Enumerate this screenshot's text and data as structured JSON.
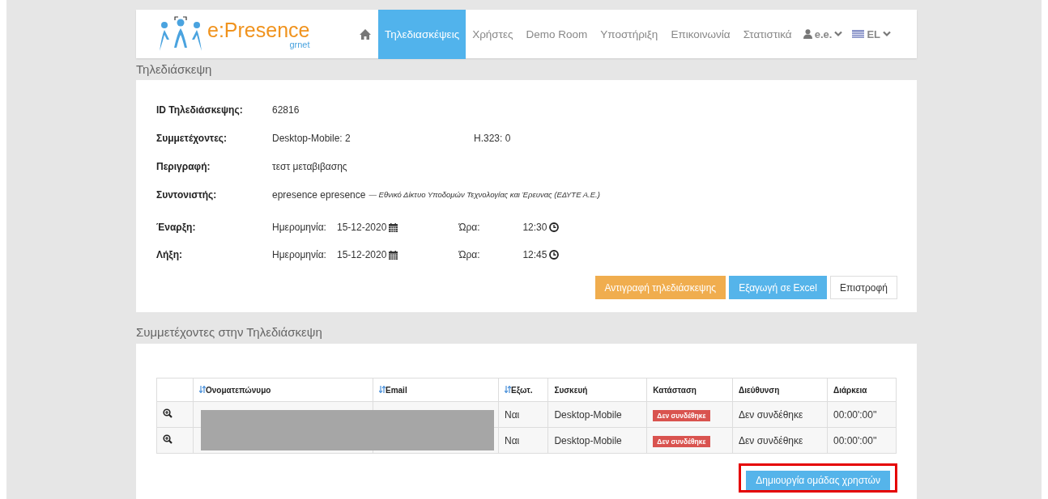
{
  "nav": {
    "logo": {
      "brand": "e:Presence",
      "sub": "grnet"
    },
    "items": [
      {
        "label": "Τηλεδιασκέψεις",
        "selected": true
      },
      {
        "label": "Χρήστες",
        "selected": false
      },
      {
        "label": "Demo Room",
        "selected": false
      },
      {
        "label": "Υποστήριξη",
        "selected": false
      },
      {
        "label": "Επικοινωνία",
        "selected": false
      },
      {
        "label": "Στατιστικά",
        "selected": false
      }
    ],
    "user": "e.e.",
    "language": "EL"
  },
  "details": {
    "title": "Τηλεδιάσκεψη",
    "id_label": "ID Τηλεδιάσκεψης:",
    "id": "62816",
    "participants_label": "Συμμετέχοντες:",
    "desktop": "Desktop-Mobile: 2",
    "h323": "H.323: 0",
    "description_label": "Περιγραφή:",
    "description": "τεστ μεταβιβασης",
    "coordinator_label": "Συντονιστής:",
    "coordinator": "epresence epresence",
    "organization": "— Εθνικό Δίκτυο Υποδομών Τεχνολογίας και Έρευνας (ΕΔΥΤΕ Α.Ε.)",
    "times": [
      {
        "label": "Έναρξη:",
        "date_label": "Ημερομηνία:",
        "date": "15-12-2020",
        "time_label": "Ώρα:",
        "time": "12:30"
      },
      {
        "label": "Λήξη:",
        "date_label": "Ημερομηνία:",
        "date": "15-12-2020",
        "time_label": "Ώρα:",
        "time": "12:45"
      }
    ],
    "buttons": [
      {
        "label": "Αντιγραφή τηλεδιάσκεψης",
        "kind": "warning"
      },
      {
        "label": "Εξαγωγή σε Excel",
        "kind": "info"
      },
      {
        "label": "Επιστροφή",
        "kind": "default"
      }
    ]
  },
  "participants": {
    "title": "Συμμετέχοντες στην Τηλεδιάσκεψη",
    "columns": [
      {
        "label": "Ονοματεπώνυμο",
        "sortable": true
      },
      {
        "label": "Email",
        "sortable": true
      },
      {
        "label": "Εξωτ.",
        "sortable": true
      },
      {
        "label": "Συσκευή",
        "sortable": false
      },
      {
        "label": "Κατάσταση",
        "sortable": false
      },
      {
        "label": "Διεύθυνση",
        "sortable": false
      },
      {
        "label": "Διάρκεια",
        "sortable": false
      }
    ],
    "rows": [
      {
        "external": "Ναι",
        "device": "Desktop-Mobile",
        "status": "Δεν συνδέθηκε",
        "address": "Δεν συνδέθηκε",
        "duration": "00:00':00''"
      },
      {
        "external": "Ναι",
        "device": "Desktop-Mobile",
        "status": "Δεν συνδέθηκε",
        "address": "Δεν συνδέθηκε",
        "duration": "00:00':00''"
      }
    ],
    "create_group": "Δημιουργία ομάδας χρηστών"
  }
}
